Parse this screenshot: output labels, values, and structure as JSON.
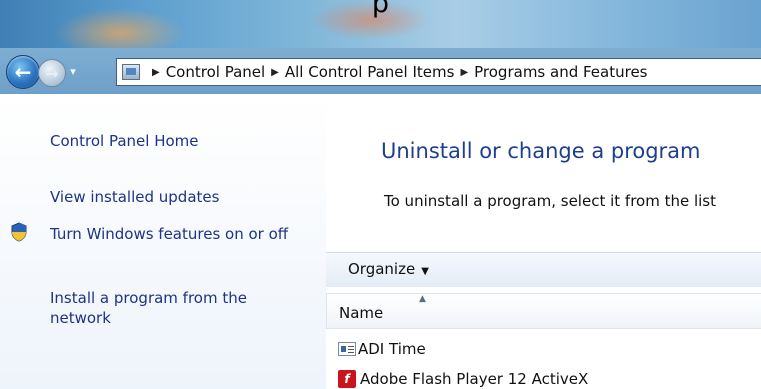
{
  "window": {
    "title_partial": "p"
  },
  "navigation": {
    "back_glyph": "←",
    "forward_glyph": "→",
    "history_glyph": "▾",
    "breadcrumb_separator": "▶",
    "breadcrumbs": [
      "Control Panel",
      "All Control Panel Items",
      "Programs and Features"
    ]
  },
  "sidebar": {
    "items": [
      {
        "label": "Control Panel Home"
      },
      {
        "label": "View installed updates"
      },
      {
        "label": "Turn Windows features on or off",
        "icon": "uac-shield-icon"
      },
      {
        "label": "Install a program from the network"
      }
    ]
  },
  "main": {
    "heading": "Uninstall or change a program",
    "description": "To uninstall a program, select it from the list",
    "toolbar": {
      "organize_label": "Organize",
      "organize_caret": "▼"
    },
    "list": {
      "columns": [
        "Name"
      ],
      "sort_indicator": "▲",
      "rows": [
        {
          "name": "ADI Time",
          "icon": "app-window-icon"
        },
        {
          "name": "Adobe Flash Player 12 ActiveX",
          "icon": "flash-icon",
          "icon_glyph": "f"
        }
      ]
    }
  },
  "colors": {
    "link": "#1e3287",
    "heading": "#1e3f8f",
    "flash_red": "#c8141b"
  }
}
